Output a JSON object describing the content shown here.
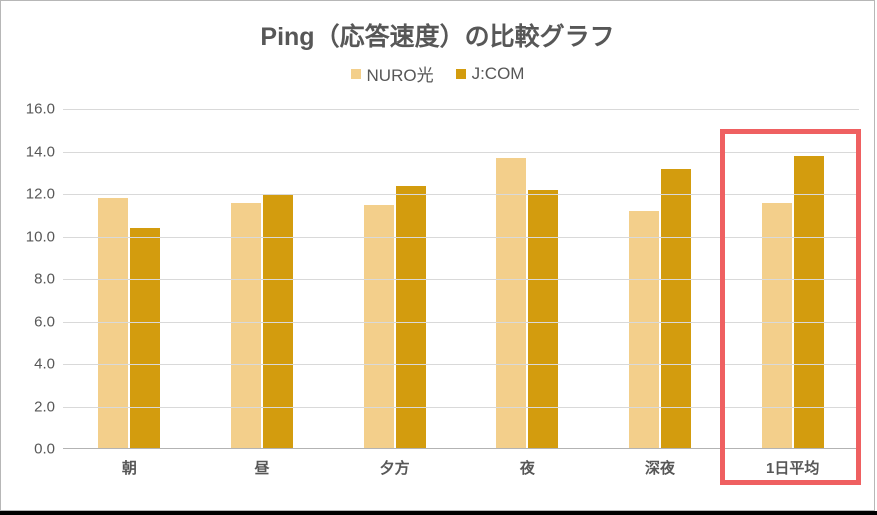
{
  "chart_data": {
    "type": "bar",
    "title": "Ping（応答速度）の比較グラフ",
    "xlabel": "",
    "ylabel": "",
    "ylim": [
      0.0,
      16.0
    ],
    "y_ticks": [
      0.0,
      2.0,
      4.0,
      6.0,
      8.0,
      10.0,
      12.0,
      14.0,
      16.0
    ],
    "categories": [
      "朝",
      "昼",
      "夕方",
      "夜",
      "深夜",
      "1日平均"
    ],
    "series": [
      {
        "name": "NURO光",
        "color": "#f3cf8b",
        "values": [
          11.8,
          11.6,
          11.5,
          13.7,
          11.2,
          11.6
        ]
      },
      {
        "name": "J:COM",
        "color": "#d39c0e",
        "values": [
          10.4,
          12.0,
          12.4,
          12.2,
          13.2,
          13.8
        ]
      }
    ],
    "highlight_category": "1日平均",
    "legend_position": "top"
  },
  "formatted": {
    "title": "Ping（応答速度）の比較グラフ",
    "legend": {
      "s0": "NURO光",
      "s1": "J:COM"
    },
    "yticks": {
      "t0": "0.0",
      "t1": "2.0",
      "t2": "4.0",
      "t3": "6.0",
      "t4": "8.0",
      "t5": "10.0",
      "t6": "12.0",
      "t7": "14.0",
      "t8": "16.0"
    },
    "xcats": {
      "c0": "朝",
      "c1": "昼",
      "c2": "夕方",
      "c3": "夜",
      "c4": "深夜",
      "c5": "1日平均"
    }
  }
}
